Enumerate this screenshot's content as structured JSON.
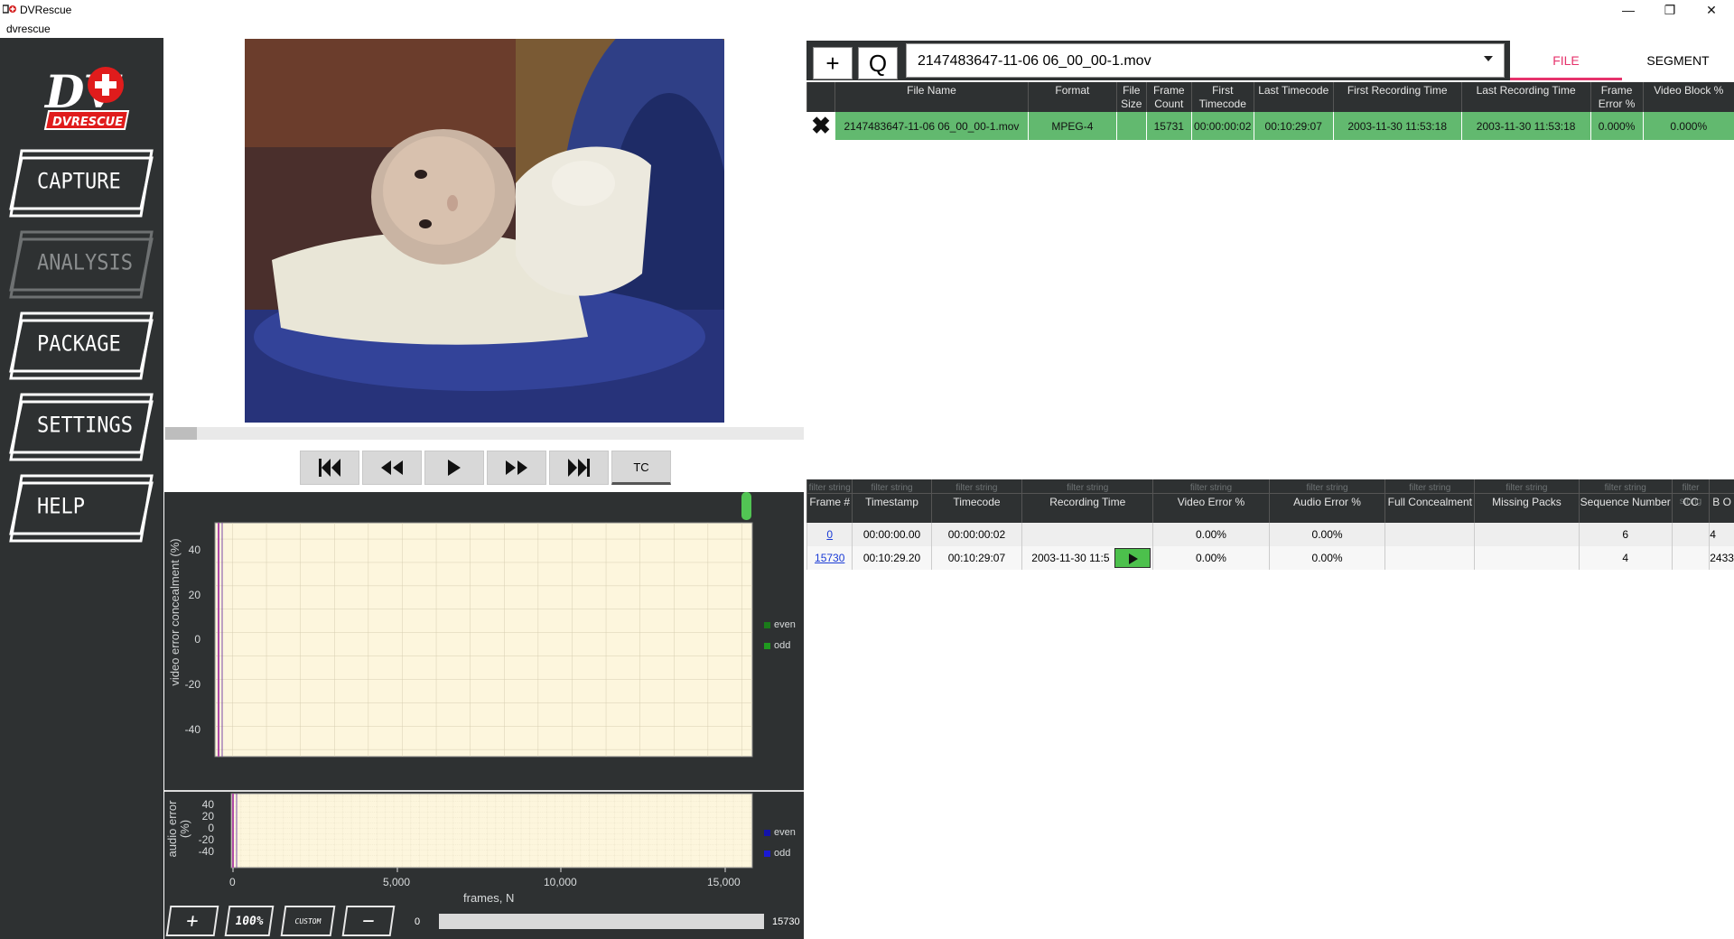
{
  "window": {
    "title": "DVRescue",
    "menu": "dvrescue",
    "minimize": "—",
    "restore": "❐",
    "close": "✕"
  },
  "sidebar": {
    "logo_text": "DVRESCUE",
    "items": [
      {
        "label": "CAPTURE",
        "enabled": true
      },
      {
        "label": "ANALYSIS",
        "enabled": false
      },
      {
        "label": "PACKAGE",
        "enabled": true
      },
      {
        "label": "SETTINGS",
        "enabled": true
      },
      {
        "label": "HELP",
        "enabled": true
      }
    ]
  },
  "player": {
    "tc_label": "TC"
  },
  "graphs": {
    "video_ylabel": "video error concealment (%)",
    "video_yticks": [
      "40",
      "20",
      "0",
      "-20",
      "-40"
    ],
    "video_legend": [
      {
        "label": "even",
        "color": "#1a7a1a"
      },
      {
        "label": "odd",
        "color": "#1f9a1f"
      }
    ],
    "audio_ylabel": "audio error (%)",
    "audio_yticks": [
      "40",
      "20",
      "0",
      "-20",
      "-40"
    ],
    "audio_legend": [
      {
        "label": "even",
        "color": "#1313a8"
      },
      {
        "label": "odd",
        "color": "#1a1ad4"
      }
    ],
    "xticks": [
      "0",
      "5,000",
      "10,000",
      "15,000"
    ],
    "xlabel": "frames, N",
    "zoom_buttons": {
      "plus": "+",
      "fit": "100%",
      "custom": "CUSTOM",
      "minus": "−"
    },
    "range_start": "0",
    "range_end": "15730"
  },
  "file_toolbar": {
    "add": "+",
    "search": "Q",
    "selected_file": "2147483647-11-06 06_00_00-1.mov"
  },
  "tabs": [
    {
      "label": "FILE",
      "active": true
    },
    {
      "label": "SEGMENT",
      "active": false
    }
  ],
  "file_table": {
    "headers": [
      "File Name",
      "Format",
      "File Size",
      "Frame Count",
      "First Timecode",
      "Last Timecode",
      "First Recording Time",
      "Last Recording Time",
      "Frame Error %",
      "Video Block %"
    ],
    "rows": [
      {
        "remove": "✖",
        "cells": [
          "2147483647-11-06 06_00_00-1.mov",
          "MPEG-4",
          "",
          "15731",
          "00:00:00:02",
          "00:10:29:07",
          "2003-11-30 11:53:18",
          "2003-11-30 11:53:18",
          "0.000%",
          "0.000%"
        ]
      }
    ]
  },
  "segment_table": {
    "filter_placeholder": "filter string",
    "headers": [
      "Frame #",
      "Timestamp",
      "Timecode",
      "Recording Time",
      "Video Error %",
      "Audio Error %",
      "Full Concealment",
      "Missing Packs",
      "Sequence Number",
      "CC",
      "B O"
    ],
    "rows": [
      {
        "frame": "0",
        "cells": [
          "00:00:00.00",
          "00:00:00:02",
          "",
          "0.00%",
          "0.00%",
          "",
          "",
          "6",
          "",
          "4"
        ]
      },
      {
        "frame": "15730",
        "cells": [
          "00:10:29.20",
          "00:10:29:07",
          "2003-11-30 11:5",
          "0.00%",
          "0.00%",
          "",
          "",
          "4",
          "",
          "2433"
        ]
      }
    ]
  }
}
